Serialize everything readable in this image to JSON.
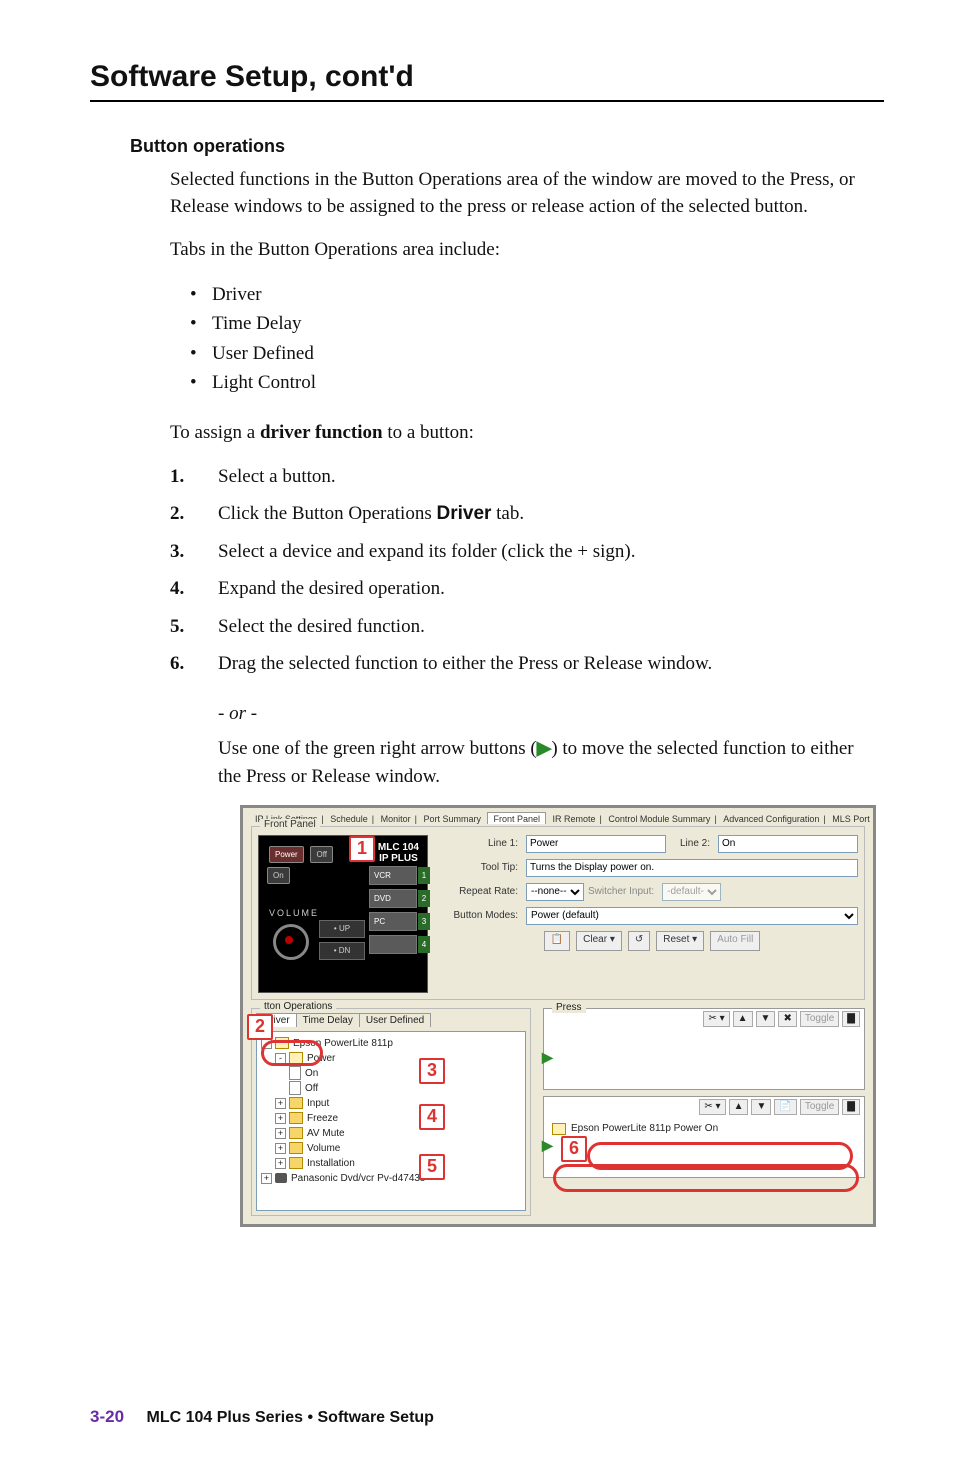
{
  "page": {
    "title": "Software Setup, cont'd",
    "section": "Button operations",
    "intro": "Selected functions in the Button Operations area of the window are moved to the Press, or Release windows to be assigned to the press or release action of the selected button.",
    "tabs_intro": "Tabs in the Button Operations area include:",
    "tabs": [
      "Driver",
      "Time Delay",
      "User Defined",
      "Light Control"
    ],
    "assign_lead_a": "To assign a ",
    "assign_lead_b": "driver function",
    "assign_lead_c": " to a button:",
    "steps": [
      "Select a button.",
      "Click the Button Operations Driver tab.",
      "Select a device and expand its folder (click the + sign).",
      "Expand the desired operation.",
      "Select the desired function.",
      "Drag the selected function to either the Press or Release window."
    ],
    "or": "- or -",
    "or_alt_a": "Use one of the green right arrow buttons (",
    "or_alt_b": ") to move the selected function to either the Press or Release window.",
    "footer_page": "3-20",
    "footer_text": "MLC 104 Plus Series • Software Setup"
  },
  "ui": {
    "top_tabs": [
      "IP Link Settings",
      "Schedule",
      "Monitor",
      "Port Summary",
      "Front Panel",
      "IR Remote",
      "Control Module Summary",
      "Advanced Configuration",
      "MLS Port"
    ],
    "top_tabs_active": "Front Panel",
    "group_label": "Front Panel",
    "device_model_a": "MLC 104",
    "device_model_b": "IP PLUS",
    "hw_btns": {
      "power": "Power",
      "on": "On",
      "off": "Off",
      "vcr": "VCR",
      "dvd": "DVD",
      "pc": "PC",
      "n4": "4",
      "volume": "VOLUME",
      "up": "• UP",
      "dn": "• DN"
    },
    "nums": [
      "1",
      "2",
      "3",
      "4"
    ],
    "props": {
      "line1_lbl": "Line 1:",
      "line1": "Power",
      "line2_lbl": "Line 2:",
      "line2": "On",
      "tooltip_lbl": "Tool Tip:",
      "tooltip": "Turns the Display power on.",
      "repeat_lbl": "Repeat Rate:",
      "repeat": "--none--",
      "sw_lbl": "Switcher Input:",
      "sw": "-default-",
      "modes_lbl": "Button Modes:",
      "modes": "Power    (default)",
      "clear": "Clear ▾",
      "reset": "Reset ▾",
      "autofill": "Auto Fill"
    },
    "ops_legend": "tton Operations",
    "mini_tabs": [
      "Driver",
      "Time Delay",
      "User Defined"
    ],
    "mini_active": "Driver",
    "tree": {
      "root": "Epson PowerLite 811p",
      "nodes": [
        {
          "lvl": 1,
          "type": "fld-open",
          "label": "Power"
        },
        {
          "lvl": 2,
          "type": "pg",
          "label": "On"
        },
        {
          "lvl": 2,
          "type": "pg",
          "label": "Off"
        },
        {
          "lvl": 1,
          "type": "fld",
          "label": "Input"
        },
        {
          "lvl": 1,
          "type": "fld",
          "label": "Freeze"
        },
        {
          "lvl": 1,
          "type": "fld",
          "label": "AV Mute"
        },
        {
          "lvl": 1,
          "type": "fld",
          "label": "Volume"
        },
        {
          "lvl": 1,
          "type": "fld",
          "label": "Installation"
        },
        {
          "lvl": 0,
          "type": "ir",
          "label": "Panasonic Dvd/vcr Pv-d4743s"
        }
      ]
    },
    "press": {
      "label": "Press",
      "toggle": "Toggle",
      "item": "Epson PowerLite 811p Power On"
    },
    "callouts": [
      "1",
      "2",
      "3",
      "4",
      "5",
      "6"
    ]
  }
}
